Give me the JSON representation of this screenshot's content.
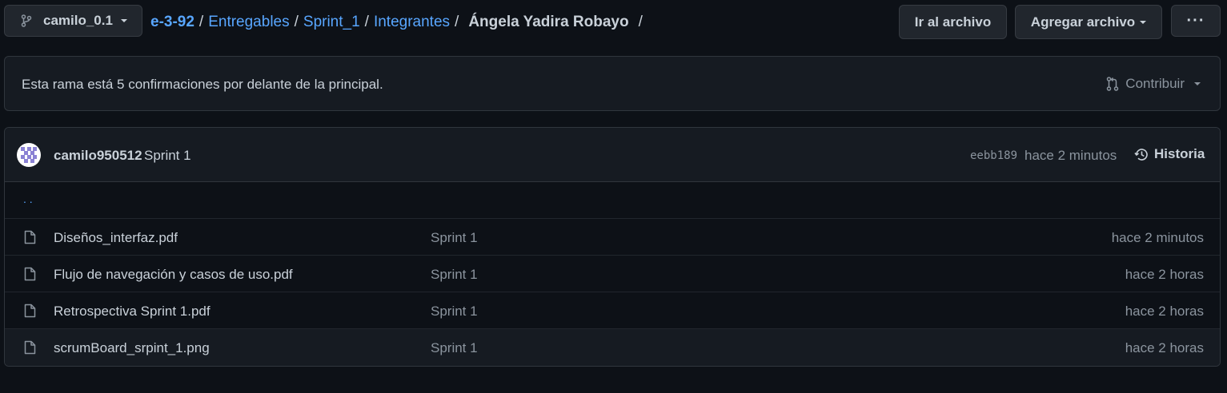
{
  "branch": {
    "name": "camilo_0.1"
  },
  "breadcrumb": {
    "repo": "e-3-92",
    "parts": [
      "Entregables",
      "Sprint_1",
      "Integrantes"
    ],
    "current": "Ángela Yadira Robayo"
  },
  "toolbar": {
    "goto_file": "Ir al archivo",
    "add_file": "Agregar archivo",
    "more": "···"
  },
  "branch_info": {
    "text": "Esta rama está 5 confirmaciones por delante de la principal.",
    "contribute": "Contribuir"
  },
  "commit": {
    "author": "camilo950512",
    "message": "Sprint 1",
    "sha": "eebb189",
    "time": "hace 2 minutos",
    "history": "Historia"
  },
  "files": {
    "parent": ". .",
    "rows": [
      {
        "name": "Diseños_interfaz.pdf",
        "message": "Sprint 1",
        "time": "hace 2 minutos"
      },
      {
        "name": "Flujo de navegación y casos de uso.pdf",
        "message": "Sprint 1",
        "time": "hace 2 horas"
      },
      {
        "name": "Retrospectiva Sprint 1.pdf",
        "message": "Sprint 1",
        "time": "hace 2 horas"
      },
      {
        "name": "scrumBoard_srpint_1.png",
        "message": "Sprint 1",
        "time": "hace 2 horas"
      }
    ]
  },
  "colors": {
    "accent": "#58a6ff",
    "background": "#0d1117",
    "surface": "#161b22"
  },
  "icons": [
    "branch-icon",
    "chevron-down-icon",
    "pull-request-icon",
    "history-icon",
    "file-icon",
    "avatar"
  ]
}
